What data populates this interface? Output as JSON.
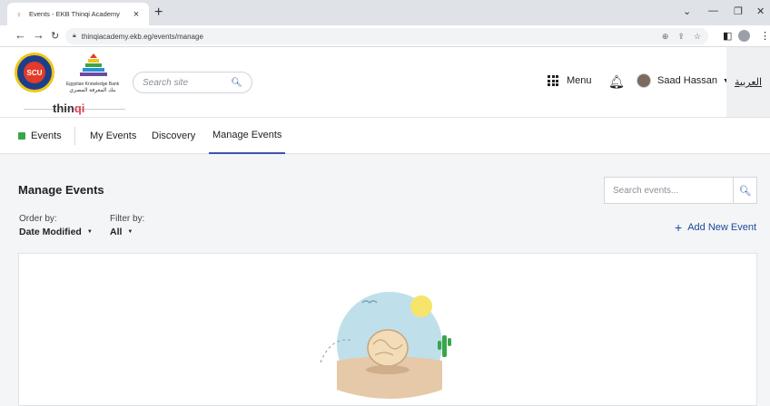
{
  "browser": {
    "tab_title": "Events - EKB Thinqi Academy",
    "url": "thinqiacademy.ekb.eg/events/manage"
  },
  "header": {
    "ekb_name_en": "Egyptian Knowledge Bank",
    "ekb_name_ar": "بنك المعرفة المصري",
    "brand_prefix": "thin",
    "brand_accent": "qi",
    "search_placeholder": "Search site",
    "menu_label": "Menu",
    "user_name": "Saad Hassan",
    "language_toggle": "العربية"
  },
  "subnav": {
    "root": "Events",
    "items": [
      "My Events",
      "Discovery",
      "Manage Events"
    ],
    "active": "Manage Events"
  },
  "main": {
    "title": "Manage Events",
    "search_placeholder": "Search events...",
    "order_label": "Order by:",
    "order_value": "Date Modified",
    "filter_label": "Filter by:",
    "filter_value": "All",
    "add_button": "Add New Event"
  },
  "icons": {
    "search": "search-icon",
    "menu": "grid-icon",
    "notifications": "bell-icon",
    "add": "plus-icon"
  },
  "colors": {
    "accent": "#1a4a9c",
    "active_tab_underline": "#3f51b5",
    "brand_accent": "#e0414f",
    "events_icon": "#3aa64a"
  }
}
